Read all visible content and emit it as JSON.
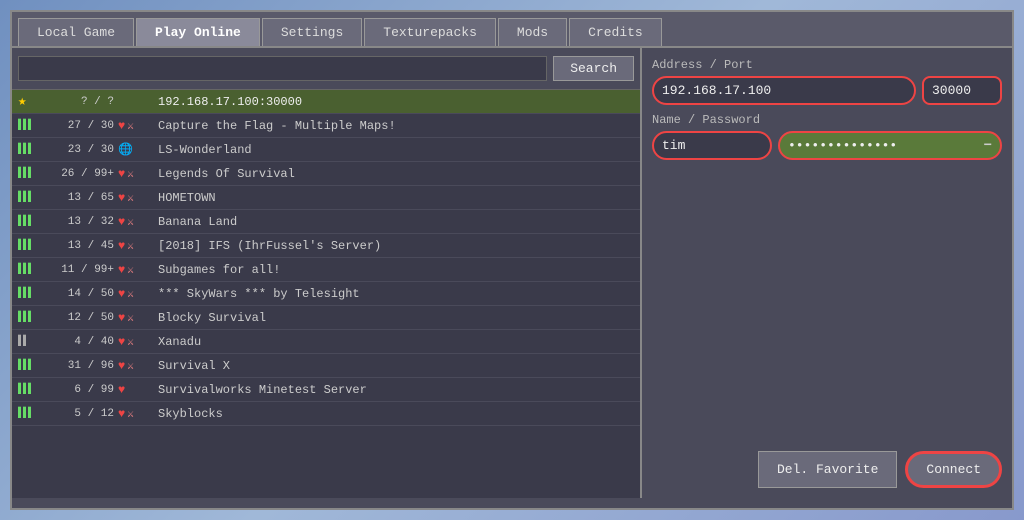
{
  "tabs": [
    {
      "label": "Local Game",
      "active": false
    },
    {
      "label": "Play Online",
      "active": true
    },
    {
      "label": "Settings",
      "active": false
    },
    {
      "label": "Texturepacks",
      "active": false
    },
    {
      "label": "Mods",
      "active": false
    },
    {
      "label": "Credits",
      "active": false
    }
  ],
  "search": {
    "placeholder": "",
    "button_label": "Search"
  },
  "servers": [
    {
      "favorite": true,
      "signal": "★",
      "players": "? /  ?",
      "icons": [
        "star"
      ],
      "name": "192.168.17.100:30000",
      "selected": true
    },
    {
      "signal": "▌▌▌",
      "players": "27 /  30",
      "icons": [
        "heart",
        "pvp"
      ],
      "name": "Capture the Flag - Multiple Maps!"
    },
    {
      "signal": "▌▌▌",
      "players": "23 /  30",
      "icons": [
        "globe"
      ],
      "name": "LS-Wonderland"
    },
    {
      "signal": "▌▌▌",
      "players": "26 / 99+",
      "icons": [
        "heart",
        "pvp"
      ],
      "name": "Legends Of Survival"
    },
    {
      "signal": "▌▌▌",
      "players": "13 /  65",
      "icons": [
        "heart",
        "pvp"
      ],
      "name": "HOMETOWN"
    },
    {
      "signal": "▌▌▌",
      "players": "13 /  32",
      "icons": [
        "heart",
        "pvp"
      ],
      "name": "Banana Land"
    },
    {
      "signal": "▌▌▌",
      "players": "13 /  45",
      "icons": [
        "heart",
        "pvp"
      ],
      "name": "[2018] IFS (IhrFussel's Server)"
    },
    {
      "signal": "▌▌▌",
      "players": "11 / 99+",
      "icons": [
        "heart",
        "pvp"
      ],
      "name": "Subgames for all!"
    },
    {
      "signal": "▌▌▌",
      "players": "14 /  50",
      "icons": [
        "heart",
        "pvp"
      ],
      "name": "*** SkyWars *** by Telesight"
    },
    {
      "signal": "▌▌▌",
      "players": "12 /  50",
      "icons": [
        "heart",
        "pvp"
      ],
      "name": "Blocky Survival"
    },
    {
      "signal": "▌▌",
      "players": " 4 /  40",
      "icons": [
        "heart",
        "pvp"
      ],
      "name": "Xanadu"
    },
    {
      "signal": "▌▌▌",
      "players": "31 /  96",
      "icons": [
        "heart",
        "pvp"
      ],
      "name": "Survival X"
    },
    {
      "signal": "▌▌▌",
      "players": " 6 /  99",
      "icons": [
        "heart"
      ],
      "name": "Survivalworks Minetest Server"
    },
    {
      "signal": "▌▌▌",
      "players": " 5 /  12",
      "icons": [
        "heart",
        "pvp"
      ],
      "name": "Skyblocks"
    }
  ],
  "right_panel": {
    "address_label": "Address / Port",
    "address_value": "192.168.17.100",
    "port_value": "30000",
    "name_password_label": "Name / Password",
    "name_value": "tim",
    "password_value": "**************",
    "del_favorite_label": "Del. Favorite",
    "connect_label": "Connect"
  }
}
